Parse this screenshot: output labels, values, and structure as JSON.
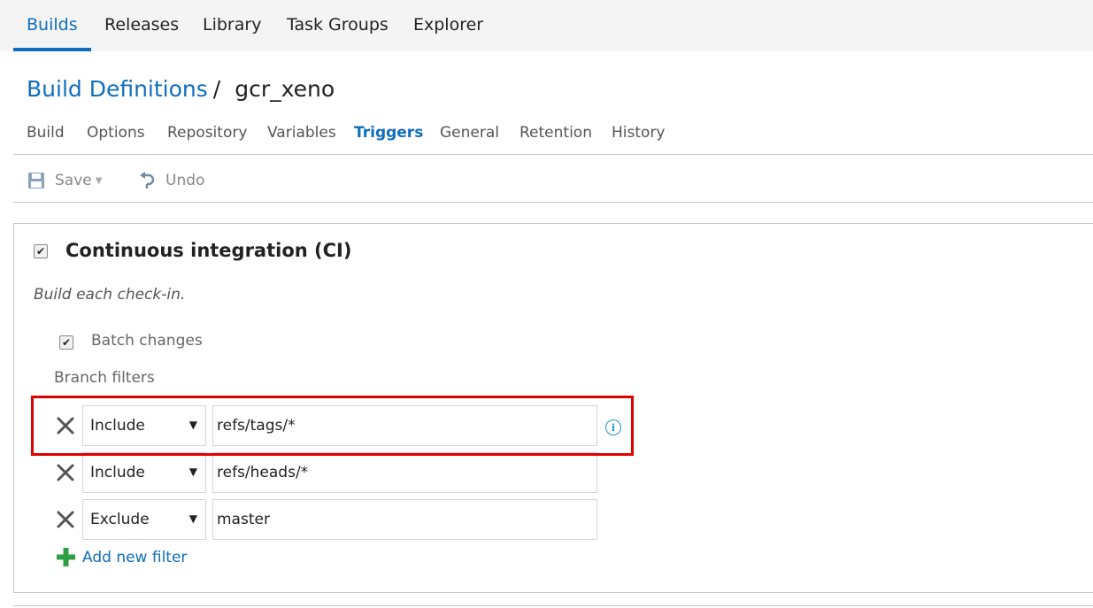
{
  "top_nav": {
    "tabs": [
      {
        "label": "Builds",
        "active": true
      },
      {
        "label": "Releases",
        "active": false
      },
      {
        "label": "Library",
        "active": false
      },
      {
        "label": "Task Groups",
        "active": false
      },
      {
        "label": "Explorer",
        "active": false
      }
    ]
  },
  "breadcrumb": {
    "parent": "Build Definitions",
    "separator": "/",
    "current": "gcr_xeno"
  },
  "sub_tabs": [
    {
      "label": "Build",
      "active": false
    },
    {
      "label": "Options",
      "active": false
    },
    {
      "label": "Repository",
      "active": false
    },
    {
      "label": "Variables",
      "active": false
    },
    {
      "label": "Triggers",
      "active": true
    },
    {
      "label": "General",
      "active": false
    },
    {
      "label": "Retention",
      "active": false
    },
    {
      "label": "History",
      "active": false
    }
  ],
  "toolbar": {
    "save_label": "Save",
    "save_icon": "floppy-disk-icon",
    "undo_label": "Undo",
    "undo_icon": "undo-arrow-icon"
  },
  "ci": {
    "checked": true,
    "title": "Continuous integration (CI)",
    "description": "Build each check-in.",
    "batch_label": "Batch changes",
    "batch_checked": true,
    "branch_filters_label": "Branch filters",
    "filters": [
      {
        "type": "Include",
        "value": "refs/tags/*"
      },
      {
        "type": "Include",
        "value": "refs/heads/*"
      },
      {
        "type": "Exclude",
        "value": "master"
      }
    ],
    "add_filter_label": "Add new filter"
  },
  "colors": {
    "accent": "#106ebe",
    "highlight_border": "#e00000",
    "add_icon": "#2ea043",
    "info_icon": "#1e90d6"
  }
}
